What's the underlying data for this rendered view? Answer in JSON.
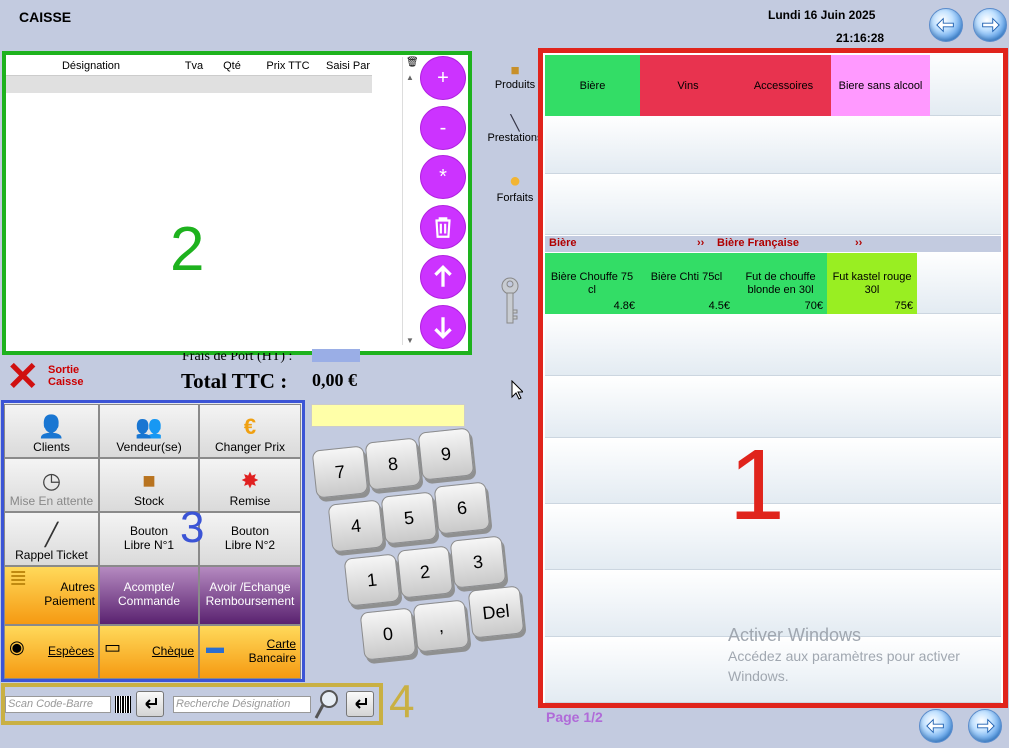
{
  "header": {
    "title": "CAISSE",
    "date": "Lundi 16 Juin 2025",
    "time": "21:16:28"
  },
  "ticket": {
    "columns": [
      "Désignation",
      "Tva",
      "Qté",
      "Prix TTC",
      "Saisi Par"
    ],
    "zone_label": "2"
  },
  "ticket_actions": {
    "plus": "+",
    "minus": "-",
    "multiply": "*"
  },
  "left_nav": {
    "produits": "Produits",
    "prestations": "Prestations",
    "forfaits": "Forfaits"
  },
  "sortie": {
    "label_line1": "Sortie",
    "label_line2": "Caisse"
  },
  "totals": {
    "frais_label": "Frais de Port (HT) :",
    "total_label": "Total TTC :",
    "total_value": "0,00 €"
  },
  "actions": {
    "clients": "Clients",
    "vendeur": "Vendeur(se)",
    "changer_prix": "Changer Prix",
    "mise_attente": "Mise En attente",
    "stock": "Stock",
    "remise": "Remise",
    "rappel_ticket": "Rappel Ticket",
    "bouton1_l1": "Bouton",
    "bouton1_l2": "Libre N°1",
    "bouton2_l1": "Bouton",
    "bouton2_l2": "Libre N°2",
    "autres_l1": "Autres",
    "autres_l2": "Paiement",
    "acompte_l1": "Acompte/",
    "acompte_l2": "Commande",
    "avoir_l1": "Avoir /Echange",
    "avoir_l2": "Remboursement",
    "especes": "Espèces",
    "cheque": "Chèque",
    "carte_l1": "Carte",
    "carte_l2": "Bancaire",
    "zone_label": "3"
  },
  "keypad": {
    "keys": [
      "7",
      "8",
      "9",
      "4",
      "5",
      "6",
      "1",
      "2",
      "3",
      "0",
      ",",
      "Del"
    ]
  },
  "search": {
    "scan_placeholder": "Scan Code-Barre",
    "designation_placeholder": "Recherche Désignation",
    "zone_label": "4"
  },
  "categories": [
    {
      "label": "Bière",
      "color": "#33dd66"
    },
    {
      "label": "Vins",
      "color": "#e8334f"
    },
    {
      "label": "Accessoires",
      "color": "#e8334f"
    },
    {
      "label": "Biere sans alcool",
      "color": "#ff99ff"
    }
  ],
  "breadcrumb": {
    "level1": "Bière",
    "sep1": "››",
    "level2": "Bière Française",
    "sep2": "››"
  },
  "products": [
    {
      "name": "Bière Chouffe 75 cl",
      "price": "4.8€",
      "color": "#33dd66"
    },
    {
      "name": "Bière Chti 75cl",
      "price": "4.5€",
      "color": "#33dd66"
    },
    {
      "name": "Fut de chouffe blonde en 30l",
      "price": "70€",
      "color": "#33dd66"
    },
    {
      "name": "Fut kastel rouge 30l",
      "price": "75€",
      "color": "#99ee22"
    }
  ],
  "products_zone_label": "1",
  "pagination": {
    "label": "Page 1/2"
  },
  "watermark": {
    "line1": "Activer Windows",
    "line2": "Accédez aux paramètres pour activer Windows."
  }
}
